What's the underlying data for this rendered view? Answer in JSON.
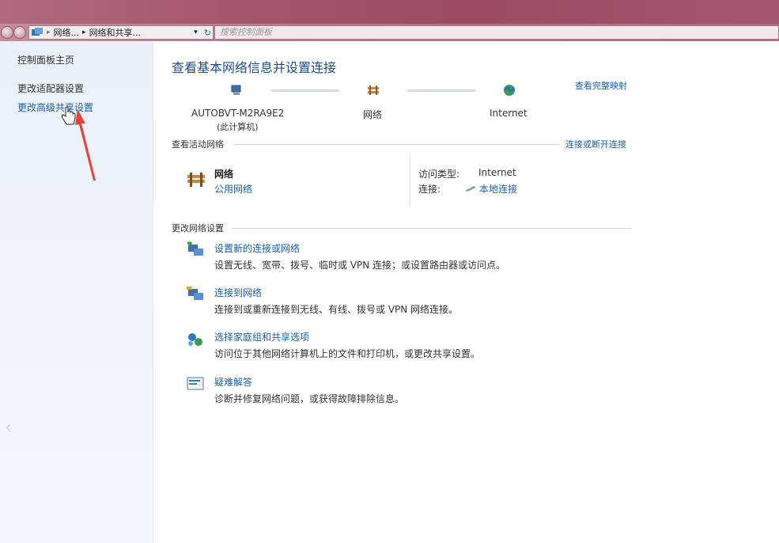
{
  "address": {
    "crumbs": [
      "网络...",
      "网络和共享..."
    ],
    "separator": "▸"
  },
  "search": {
    "placeholder": "搜索控制面板"
  },
  "sidebar": {
    "items": [
      {
        "label": "控制面板主页"
      },
      {
        "label": "更改适配器设置"
      },
      {
        "label": "更改高级共享设置"
      }
    ]
  },
  "main": {
    "title": "查看基本网络信息并设置连接",
    "see_full_map": "查看完整映射",
    "map": {
      "computer_name": "AUTOBVT-M2RA9E2",
      "computer_sub": "(此计算机)",
      "network": "网络",
      "internet": "Internet"
    },
    "active_networks": {
      "label": "查看活动网络",
      "connect_disconnect": "连接或断开连接",
      "network_name": "网络",
      "network_type": "公用网络",
      "access_type_label": "访问类型:",
      "access_type_value": "Internet",
      "connections_label": "连接:",
      "connections_value": "本地连接"
    },
    "change_settings": {
      "label": "更改网络设置",
      "tasks": [
        {
          "title": "设置新的连接或网络",
          "desc": "设置无线、宽带、拨号、临时或 VPN 连接；或设置路由器或访问点。",
          "icon": "new-connection-icon"
        },
        {
          "title": "连接到网络",
          "desc": "连接到或重新连接到无线、有线、拨号或 VPN 网络连接。",
          "icon": "connect-network-icon"
        },
        {
          "title": "选择家庭组和共享选项",
          "desc": "访问位于其他网络计算机上的文件和打印机，或更改共享设置。",
          "icon": "homegroup-icon"
        },
        {
          "title": "疑难解答",
          "desc": "诊断并修复网络问题，或获得故障排除信息。",
          "icon": "troubleshoot-icon"
        }
      ]
    }
  },
  "colors": {
    "accent": "#1e5fa8",
    "annotation": "#e8403a"
  }
}
